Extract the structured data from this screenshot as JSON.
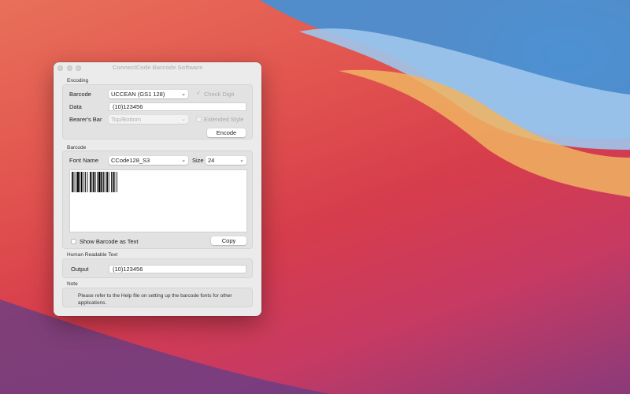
{
  "window": {
    "title": "ConnectCode Barcode Software"
  },
  "encoding": {
    "section_label": "Encoding",
    "barcode_label": "Barcode",
    "barcode_value": "UCCEAN (GS1 128)",
    "check_digit_label": "Check Digit",
    "check_digit_checked": true,
    "data_label": "Data",
    "data_value": "(10)123456",
    "bearers_bar_label": "Bearer's Bar",
    "bearers_bar_value": "Top/Bottom",
    "extended_style_label": "Extended Style",
    "extended_style_checked": false,
    "encode_button": "Encode"
  },
  "barcode": {
    "section_label": "Barcode",
    "font_name_label": "Font Name",
    "font_name_value": "CCode128_S3",
    "size_label": "Size",
    "size_value": "24",
    "show_as_text_label": "Show Barcode as Text",
    "show_as_text_checked": false,
    "copy_button": "Copy"
  },
  "human_readable": {
    "section_label": "Human Readable Text",
    "output_label": "Output",
    "output_value": "(10)123456"
  },
  "note": {
    "section_label": "Note",
    "text": "Please refer to the Help file on setting up the barcode fonts for other applications."
  },
  "icons": {
    "dropdown": "chevron-updown-icon",
    "check": "checkmark-icon"
  },
  "colors": {
    "window_bg": "#ecebeb",
    "group_bg": "#e3e2e2",
    "barcode_bars": "#000000"
  }
}
